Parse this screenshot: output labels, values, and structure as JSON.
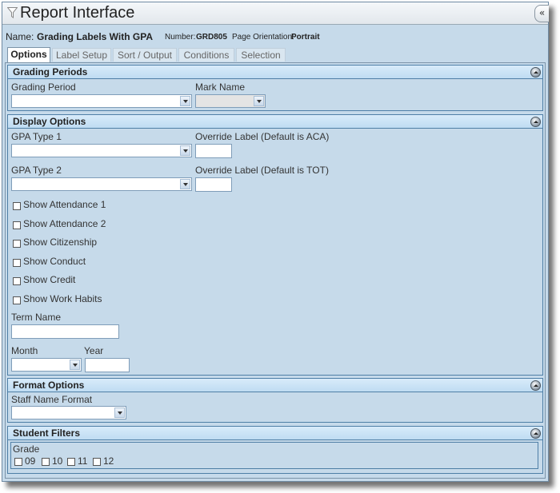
{
  "window": {
    "title": "Report Interface",
    "collapse_label": "«"
  },
  "report": {
    "name_label": "Name:",
    "name_value": "Grading Labels With GPA",
    "number_label": "Number:",
    "number_value": "GRD805",
    "orientation_label": "Page Orientation:",
    "orientation_value": "Portrait"
  },
  "tabs": [
    {
      "label": "Options",
      "active": true
    },
    {
      "label": "Label Setup"
    },
    {
      "label": "Sort / Output"
    },
    {
      "label": "Conditions"
    },
    {
      "label": "Selection"
    }
  ],
  "sections": {
    "grading_periods": {
      "title": "Grading Periods",
      "grading_period_label": "Grading Period",
      "grading_period_value": "",
      "mark_name_label": "Mark Name",
      "mark_name_value": ""
    },
    "display_options": {
      "title": "Display Options",
      "gpa_type1_label": "GPA Type 1",
      "override1_label": "Override Label (Default is ACA)",
      "gpa_type2_label": "GPA Type 2",
      "override2_label": "Override Label (Default is TOT)",
      "checkboxes": [
        "Show Attendance 1",
        "Show Attendance 2",
        "Show Citizenship",
        "Show Conduct",
        "Show Credit",
        "Show Work Habits"
      ],
      "term_name_label": "Term Name",
      "month_label": "Month",
      "year_label": "Year"
    },
    "format_options": {
      "title": "Format Options",
      "staff_name_format_label": "Staff Name Format"
    },
    "student_filters": {
      "title": "Student Filters",
      "grade_label": "Grade",
      "grades": [
        "09",
        "10",
        "11",
        "12"
      ]
    }
  }
}
